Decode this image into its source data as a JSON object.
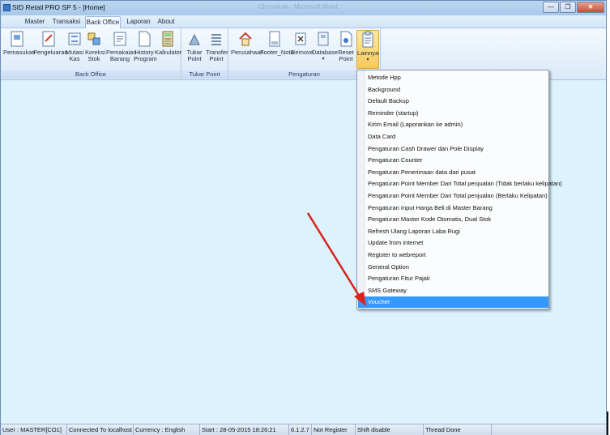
{
  "window": {
    "title": "SID Retail PRO SP 5 - [Home]",
    "ghost_title": "Chromium - Microsoft Word"
  },
  "menu": {
    "tabs": [
      {
        "label": "Master"
      },
      {
        "label": "Transaksi"
      },
      {
        "label": "Back Office"
      },
      {
        "label": "Laporan"
      },
      {
        "label": "About"
      }
    ],
    "active": "Back Office"
  },
  "ribbon": {
    "groups": [
      {
        "label": "Back Office",
        "buttons": [
          {
            "label": "Pemasukan",
            "icon": "cash-in-icon"
          },
          {
            "label": "Pengeluaran",
            "icon": "cash-out-icon"
          },
          {
            "label": "Mutasi\nKas",
            "icon": "cash-transfer-icon"
          },
          {
            "label": "Koreksi\nStok",
            "icon": "stock-correction-icon"
          },
          {
            "label": "Pemakaian\nBarang",
            "icon": "item-usage-icon"
          },
          {
            "label": "History\nProgram",
            "icon": "document-icon"
          },
          {
            "label": "Kalkulator",
            "icon": "calculator-icon"
          }
        ]
      },
      {
        "label": "Tukar Point",
        "buttons": [
          {
            "label": "Tukar\nPoint",
            "icon": "exchange-icon"
          },
          {
            "label": "Transfer\nPoint",
            "icon": "transfer-list-icon"
          }
        ]
      },
      {
        "label": "Pengaturan",
        "buttons": [
          {
            "label": "Perusahaan",
            "icon": "house-icon"
          },
          {
            "label": "Footer_Nota",
            "icon": "note-icon"
          },
          {
            "label": "Remove",
            "icon": "remove-icon"
          },
          {
            "label": "Database",
            "icon": "database-icon"
          },
          {
            "label": "Reset\nPoint",
            "icon": "reset-icon"
          },
          {
            "label": "Lainnya",
            "icon": "clipboard-icon"
          }
        ]
      }
    ]
  },
  "dropdown": {
    "items": [
      "Metode Hpp",
      "Background",
      "Default Backup",
      "Reminder (startup)",
      "Kirim Email (Laporankan ke admin)",
      "Data Card",
      "Pengaturan Cash Drawer dan Pole Display",
      "Pengaturan Counter",
      "Pengaturan Penerimaan data dari pusat",
      "Pengaturan Point Member Dari Total penjualan (Tidak berlaku kelipatan)",
      "Pengaturan Point Member Dari Total penjualan (Berlaku Kelipatan)",
      "Pengaturan Input Harga Beli di Master Barang",
      "Pengaturan Master Kode Otomatis, Dual Stok",
      "Refresh Ulang Laporan Laba Rugi",
      "Update from internet",
      "Register to webreport",
      "General Option",
      "Pengaturan Fitur Pajak",
      "SMS Gateway",
      "Voucher"
    ],
    "selected": "Voucher"
  },
  "annotation": {
    "color": "#d9231e"
  },
  "statusbar": {
    "user": "User : MASTER[CO1]",
    "connection": "Connected To localhost",
    "currency": "Currency : English",
    "start": "Start : 28-05-2015 18:26:21",
    "version": "6.1.2.7",
    "register": "Not Register",
    "shift": "Shift disable",
    "thread": "Thread Done"
  },
  "colors": {
    "accent": "#3399ff",
    "content_bg": "#dcf2fc",
    "active_button": "#f7c95a"
  }
}
